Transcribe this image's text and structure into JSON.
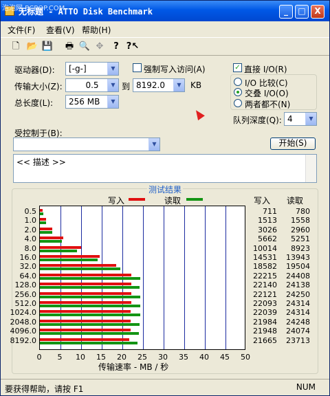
{
  "window": {
    "title": "无标题 - ATTO Disk Benchmark",
    "watermark": "泡泡网 PCPOP.COM",
    "minimize": "_",
    "maximize": "□",
    "close": "X"
  },
  "menu": {
    "file": "文件(F)",
    "view": "查看(V)",
    "help": "帮助(H)"
  },
  "toolbar": {
    "new": "🗋",
    "open": "📂",
    "save": "💾",
    "print": "🖶",
    "preview": "🔍",
    "move": "✥",
    "help": "?",
    "whatis": "?↖"
  },
  "settings": {
    "drive_label": "驱动器(D):",
    "drive_value": "[-g-]",
    "force_write_label": "强制写入访问(A)",
    "transfer_label": "传输大小(Z):",
    "transfer_from": "0.5",
    "transfer_to_label": "到",
    "transfer_to": "8192.0",
    "transfer_unit": "KB",
    "total_label": "总长度(L):",
    "total_value": "256 MB",
    "direct_io_label": "直接 I/O(R)",
    "io_compare_label": "I/O 比较(C)",
    "overlap_io_label": "交叠 I/O(O)",
    "neither_label": "两者都不(N)",
    "queue_label": "队列深度(Q):",
    "queue_value": "4",
    "controlled_label": "受控制于(B):",
    "controlled_value": "",
    "start_button": "开始(S)",
    "description": "<< 描述 >>"
  },
  "results": {
    "title": "测试结果",
    "write_legend": "写入",
    "read_legend": "读取",
    "col_write": "写入",
    "col_read": "读取",
    "xlabel": "传输速率 - MB / 秒",
    "write_color": "#e01010",
    "read_color": "#149414"
  },
  "chart_data": {
    "type": "bar",
    "orientation": "horizontal",
    "categories": [
      "0.5",
      "1.0",
      "2.0",
      "4.0",
      "8.0",
      "16.0",
      "32.0",
      "64.0",
      "128.0",
      "256.0",
      "512.0",
      "1024.0",
      "2048.0",
      "4096.0",
      "8192.0"
    ],
    "series": [
      {
        "name": "写入",
        "values": [
          0.711,
          1.513,
          3.026,
          5.662,
          10.014,
          14.531,
          18.582,
          22.215,
          22.14,
          22.121,
          22.093,
          22.039,
          21.984,
          21.948,
          21.665
        ]
      },
      {
        "name": "读取",
        "values": [
          0.78,
          1.558,
          2.96,
          5.251,
          8.923,
          13.943,
          19.504,
          24.408,
          24.138,
          24.25,
          24.314,
          24.314,
          24.248,
          24.074,
          23.713
        ]
      }
    ],
    "write_numbers": [
      "711",
      "1513",
      "3026",
      "5662",
      "10014",
      "14531",
      "18582",
      "22215",
      "22140",
      "22121",
      "22093",
      "22039",
      "21984",
      "21948",
      "21665"
    ],
    "read_numbers": [
      "780",
      "1558",
      "2960",
      "5251",
      "8923",
      "13943",
      "19504",
      "24408",
      "24138",
      "24250",
      "24314",
      "24314",
      "24248",
      "24074",
      "23713"
    ],
    "xticks": [
      "0",
      "5",
      "10",
      "15",
      "20",
      "25",
      "30",
      "35",
      "40",
      "45",
      "50"
    ],
    "xlim": [
      0,
      50
    ],
    "xlabel": "传输速率 - MB / 秒",
    "grid": true
  },
  "status": {
    "text": "要获得帮助，请按 F1",
    "right": "NUM"
  }
}
